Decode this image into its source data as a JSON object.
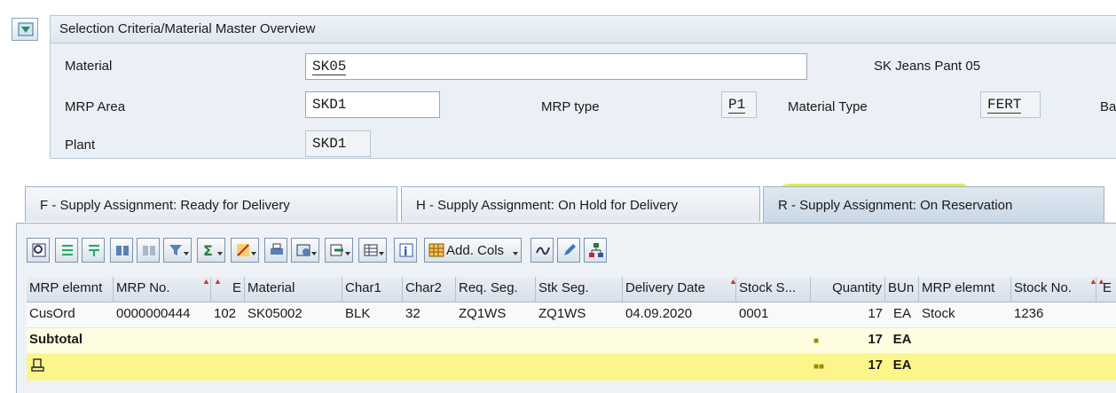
{
  "header": {
    "title": "Selection Criteria/Material Master Overview"
  },
  "fields": {
    "material_label": "Material",
    "material_value": "SK05",
    "material_desc": "SK Jeans Pant 05",
    "mrp_area_label": "MRP Area",
    "mrp_area_value": "SKD1",
    "mrp_type_label": "MRP type",
    "mrp_type_value": "P1",
    "material_type_label": "Material Type",
    "material_type_value": "FERT",
    "base_unit_label_partial": "Bas",
    "plant_label": "Plant",
    "plant_value": "SKD1"
  },
  "tabs": [
    {
      "label": "F - Supply Assignment: Ready for Delivery"
    },
    {
      "label": "H - Supply Assignment: On Hold for Delivery"
    },
    {
      "label": "R - Supply Assignment: On Reservation"
    }
  ],
  "toolbar": {
    "add_cols_label": "Add. Cols",
    "icons": [
      "details-icon",
      "sort-ascending-icon",
      "sort-descending-icon",
      "find-icon",
      "find-next-icon",
      "filter-icon",
      "sum-icon",
      "subtotal-icon",
      "print-icon",
      "views-icon",
      "export-icon",
      "layout-icon",
      "info-icon",
      "add-columns-icon",
      "graphic-icon",
      "edit-icon",
      "hierarchy-icon"
    ]
  },
  "table": {
    "columns": [
      "MRP elemnt",
      "MRP No.",
      "E",
      "Material",
      "Char1",
      "Char2",
      "Req. Seg.",
      "Stk Seg.",
      "Delivery Date",
      "Stock S...",
      "Quantity",
      "BUn",
      "MRP elemnt",
      "Stock No.",
      "E"
    ],
    "rows": [
      [
        "CusOrd",
        "0000000444",
        "102",
        "SK05002",
        "BLK",
        "32",
        "ZQ1WS",
        "ZQ1WS",
        "04.09.2020",
        "0001",
        "17",
        "EA",
        "Stock",
        "1236",
        ""
      ]
    ],
    "subtotal_label": "Subtotal",
    "subtotal_qty": "17",
    "subtotal_unit": "EA",
    "total_qty": "17",
    "total_unit": "EA"
  },
  "colors": {
    "highlight": "#d7e61e",
    "total_row": "#fbf58a",
    "subtotal_row": "#fffde0"
  }
}
